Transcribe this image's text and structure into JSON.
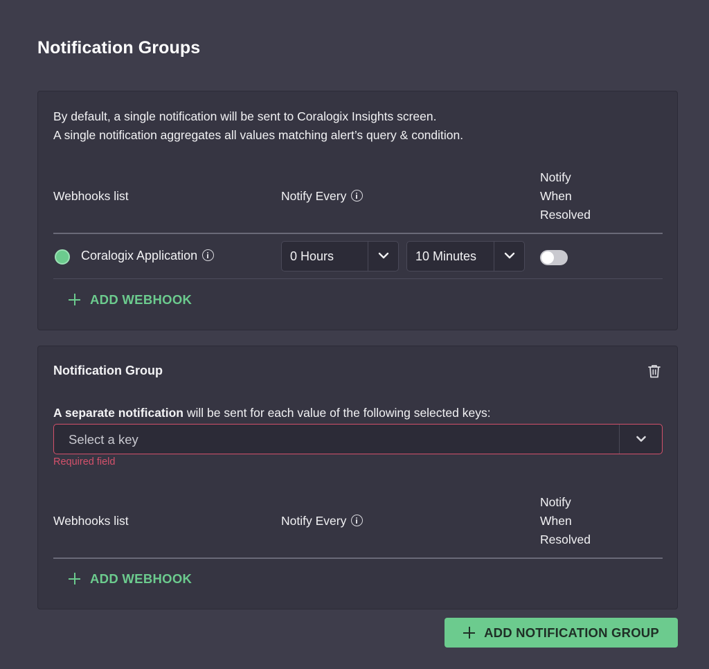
{
  "page": {
    "title": "Notification Groups"
  },
  "default_panel": {
    "description_line1": "By default, a single notification will be sent to Coralogix Insights screen.",
    "description_line2": "A single notification aggregates all values matching alert’s query & condition.",
    "columns": {
      "webhooks": "Webhooks list",
      "notify_every": "Notify Every",
      "notify_resolved_1": "Notify",
      "notify_resolved_2": "When",
      "notify_resolved_3": "Resolved"
    },
    "webhook": {
      "name": "Coralogix Application",
      "status_color": "#6ccb8e",
      "hours": "0 Hours",
      "minutes": "10 Minutes",
      "notify_when_resolved": false
    },
    "add_webhook_label": "ADD WEBHOOK"
  },
  "group_panel": {
    "title": "Notification Group",
    "key_desc_bold": "A separate notification",
    "key_desc_rest": " will be sent for each value of the following selected keys:",
    "key_placeholder": "Select a key",
    "required_text": "Required field",
    "columns": {
      "webhooks": "Webhooks list",
      "notify_every": "Notify Every",
      "notify_resolved_1": "Notify",
      "notify_resolved_2": "When",
      "notify_resolved_3": "Resolved"
    },
    "add_webhook_label": "ADD WEBHOOK"
  },
  "add_group_label": "ADD NOTIFICATION GROUP",
  "colors": {
    "accent": "#6ccb8e",
    "error": "#d4516b",
    "background": "#3e3d4b",
    "panel": "#363542"
  }
}
